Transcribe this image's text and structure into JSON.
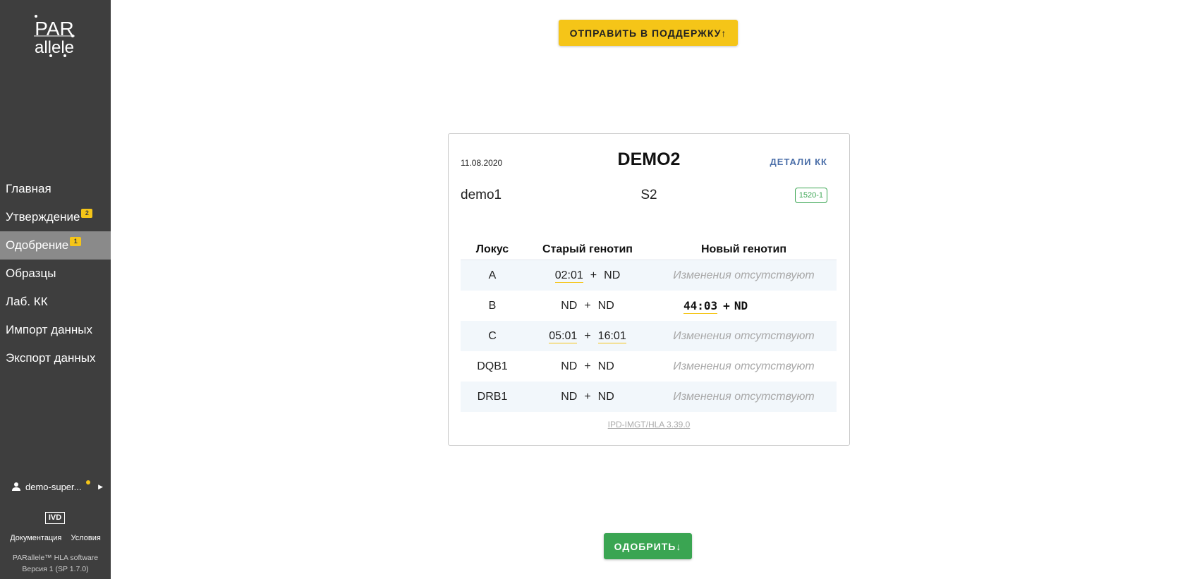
{
  "sidebar": {
    "logo_top": "PAR",
    "logo_bottom": "allele",
    "nav": [
      {
        "label": "Главная",
        "badge": null,
        "active": false
      },
      {
        "label": "Утверждение",
        "badge": "2",
        "active": false
      },
      {
        "label": "Одобрение",
        "badge": "1",
        "active": true
      },
      {
        "label": "Образцы",
        "badge": null,
        "active": false
      },
      {
        "label": "Лаб. КК",
        "badge": null,
        "active": false
      },
      {
        "label": "Импорт данных",
        "badge": null,
        "active": false
      },
      {
        "label": "Экспорт данных",
        "badge": null,
        "active": false
      }
    ],
    "user": "demo-super...",
    "ivd": "IVD",
    "docs_link": "Документация",
    "terms_link": "Условия",
    "product": "PARallele™ HLA software",
    "version": "Версия 1 (SP 1.7.0)"
  },
  "buttons": {
    "support": "ОТПРАВИТЬ В ПОДДЕРЖКУ↑",
    "approve": "ОДОБРИТЬ↓"
  },
  "card": {
    "date": "11.08.2020",
    "title": "DEMO2",
    "details_link": "ДЕТАЛИ КК",
    "sample": "demo1",
    "sample_code": "S2",
    "tag": "1520-1",
    "columns": {
      "locus": "Локус",
      "old": "Старый генотип",
      "new": "Новый генотип"
    },
    "rows": [
      {
        "locus": "A",
        "old1": "02:01",
        "old1_ul": true,
        "old2": "ND",
        "old2_ul": false,
        "new_text": "Изменения отсутствуют",
        "new1": null,
        "new2": null
      },
      {
        "locus": "B",
        "old1": "ND",
        "old1_ul": false,
        "old2": "ND",
        "old2_ul": false,
        "new_text": null,
        "new1": "44:03",
        "new2": "ND"
      },
      {
        "locus": "C",
        "old1": "05:01",
        "old1_ul": true,
        "old2": "16:01",
        "old2_ul": true,
        "new_text": "Изменения отсутствуют",
        "new1": null,
        "new2": null
      },
      {
        "locus": "DQB1",
        "old1": "ND",
        "old1_ul": false,
        "old2": "ND",
        "old2_ul": false,
        "new_text": "Изменения отсутствуют",
        "new1": null,
        "new2": null
      },
      {
        "locus": "DRB1",
        "old1": "ND",
        "old1_ul": false,
        "old2": "ND",
        "old2_ul": false,
        "new_text": "Изменения отсутствуют",
        "new1": null,
        "new2": null
      }
    ],
    "plus": "+",
    "reference": "IPD-IMGT/HLA 3.39.0"
  },
  "colors": {
    "sidebar_bg": "#3e3e3e",
    "active_nav": "#8a8a8a",
    "accent_yellow": "#f5c518",
    "approve_green": "#3aa552",
    "link_blue": "#4a6ea8"
  }
}
